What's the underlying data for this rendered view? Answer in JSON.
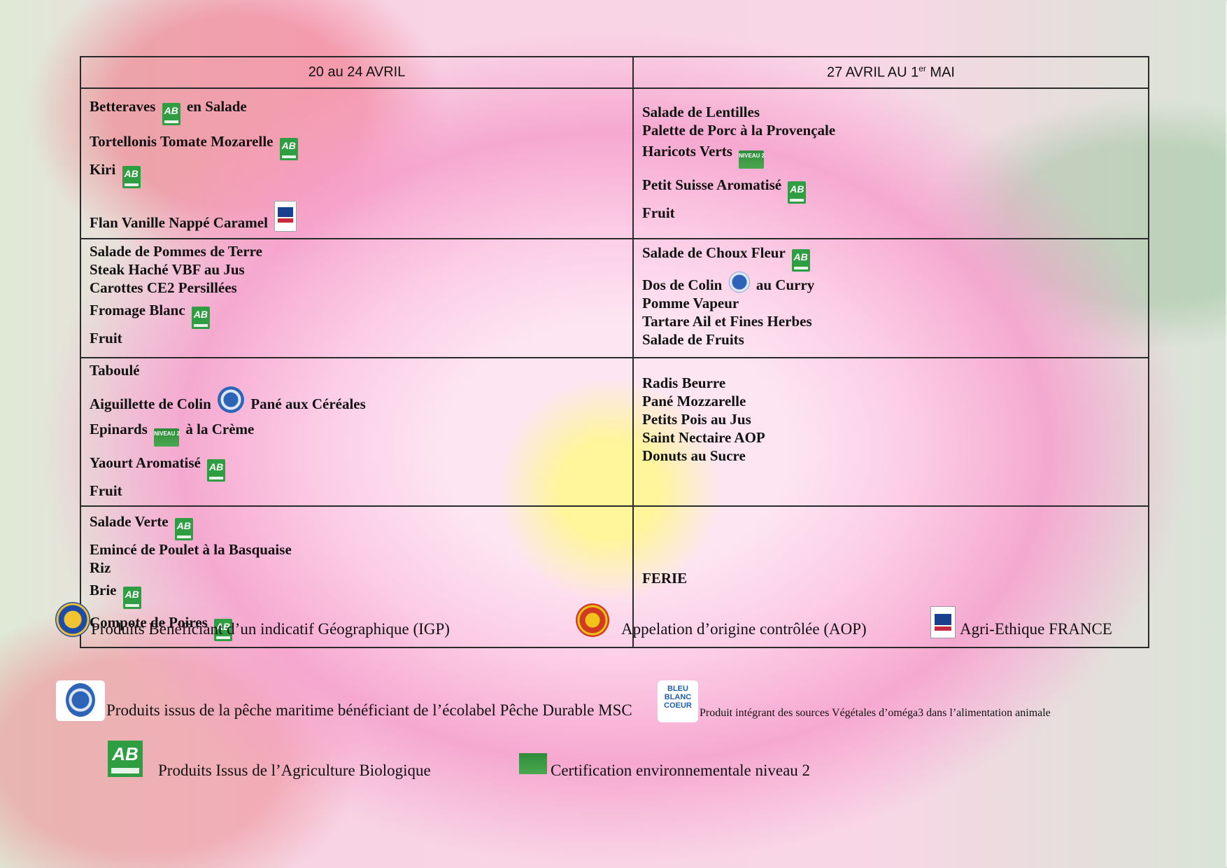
{
  "headers": [
    "20 au 24 AVRIL",
    "27 AVRIL AU 1",
    "er",
    " MAI"
  ],
  "week1": {
    "r1": [
      "Betteraves",
      "en Salade",
      "Tortellonis Tomate Mozarelle",
      "Kiri",
      "Flan Vanille Nappé Caramel"
    ],
    "r2": [
      "Salade de Pommes de Terre",
      "Steak Haché VBF au Jus",
      "Carottes CE2 Persillées",
      "Fromage Blanc",
      "Fruit"
    ],
    "r3": [
      "Taboulé",
      "Aiguillette de Colin",
      "Pané aux Céréales",
      "Epinards",
      "à la Crème",
      "Yaourt Aromatisé",
      "Fruit"
    ],
    "r4": [
      "Salade Verte",
      "Emincé de Poulet à la Basquaise",
      "Riz",
      "Brie",
      "Compote de Poires"
    ]
  },
  "week2": {
    "r1": [
      "Salade de Lentilles",
      "Palette de Porc à la Provençale",
      "Haricots Verts",
      "Petit Suisse Aromatisé",
      "Fruit"
    ],
    "r2": [
      "Salade de Choux Fleur",
      "Dos de Colin",
      "au Curry",
      "Pomme Vapeur",
      "Tartare Ail et Fines Herbes",
      "Salade de Fruits"
    ],
    "r3": [
      "Radis Beurre",
      "Pané Mozzarelle",
      "Petits Pois au Jus",
      "Saint Nectaire AOP",
      "Donuts au Sucre"
    ],
    "r4": [
      "FERIE"
    ]
  },
  "badges": {
    "ab_text": "AB",
    "envi_text": "NIVEAU 2",
    "bbc_text": "BLEU BLANC COEUR"
  },
  "legend": {
    "igp": "Produits Bénéficiant d’un indicatif Géographique (IGP)",
    "aop": "Appelation d’origine contrôlée (AOP)",
    "agri": "Agri-Ethique FRANCE",
    "msc": "Produits issus de la pêche maritime bénéficiant de l’écolabel Pêche Durable MSC",
    "bbc": "Produit intégrant des sources Végétales d’oméga3 dans l’alimentation animale",
    "bio": "Produits Issus de l’Agriculture Biologique",
    "envi": "Certification environnementale niveau 2"
  }
}
